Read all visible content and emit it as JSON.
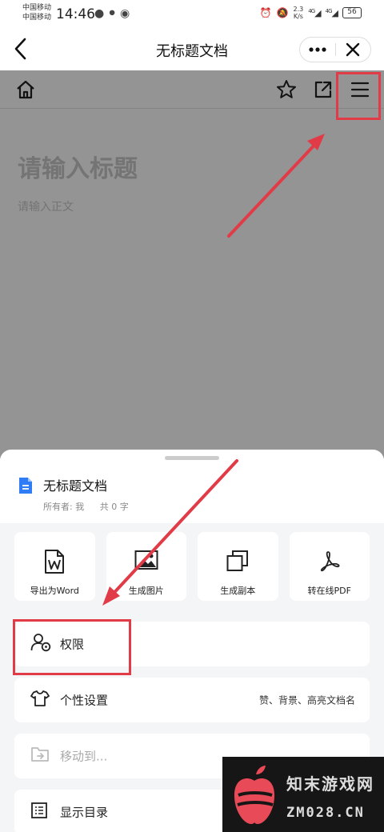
{
  "status_bar": {
    "carrier_1": "中国移动",
    "carrier_2": "中国移动",
    "time": "14:46",
    "net_speed_value": "2.3",
    "net_speed_unit": "K/s",
    "signal_1": "4G",
    "signal_2": "4G",
    "battery": "56"
  },
  "title_bar": {
    "title": "无标题文档",
    "icons": [
      "back-icon",
      "more-icon",
      "close-icon"
    ]
  },
  "editor": {
    "title_placeholder": "请输入标题",
    "body_placeholder": "请输入正文",
    "toolbar_icons": [
      "home-icon",
      "star-icon",
      "share-icon",
      "menu-icon"
    ]
  },
  "menu_sheet": {
    "doc_title": "无标题文档",
    "owner": "所有者: 我",
    "word_count": "共 0 字",
    "actions": [
      {
        "label": "导出为Word",
        "icon": "word-icon"
      },
      {
        "label": "生成图片",
        "icon": "image-icon"
      },
      {
        "label": "生成副本",
        "icon": "copy-icon"
      },
      {
        "label": "转在线PDF",
        "icon": "pdf-icon"
      }
    ],
    "rows": [
      {
        "label": "权限",
        "icon": "permission-icon",
        "value": ""
      },
      {
        "label": "个性设置",
        "icon": "shirt-icon",
        "value": "赞、背景、高亮文档名"
      },
      {
        "label": "移动到...",
        "icon": "folder-move-icon",
        "value": ""
      },
      {
        "label": "显示目录",
        "icon": "catalog-icon",
        "value": ""
      }
    ]
  },
  "watermark": {
    "text": "知末游戏网",
    "site": "ZM028.CN"
  },
  "colors": {
    "annotation": "#e23b48",
    "doc_icon_blue": "#2f7cf6"
  }
}
